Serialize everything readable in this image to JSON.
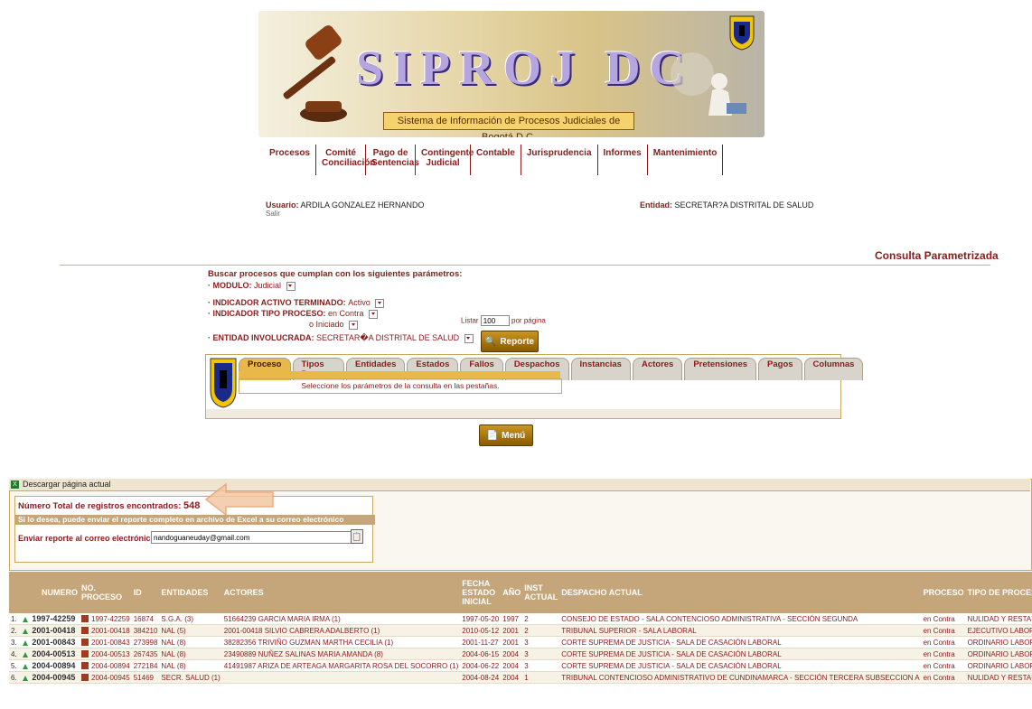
{
  "banner": {
    "title": "SIPROJ DC",
    "subtitle": "Sistema de Información de Procesos Judiciales de Bogotá D.C."
  },
  "menu": [
    "Procesos",
    "Comité Conciliación",
    "Pago de Sentencias",
    "Contingente Judicial",
    "Contable",
    "Jurisprudencia",
    "Informes",
    "Mantenimiento"
  ],
  "user": {
    "label": "Usuario:",
    "name": "ARDILA GONZALEZ HERNANDO",
    "logout": "Salir",
    "entity_label": "Entidad:",
    "entity": "SECRETAR?A DISTRITAL DE SALUD"
  },
  "page_title": "Consulta Parametrizada",
  "params": {
    "heading": "Buscar procesos que cumplan con los siguientes parámetros:",
    "modulo_label": "· MODULO:",
    "modulo_value": "Judicial",
    "indicador_activo_label": "· INDICADOR ACTIVO TERMINADO:",
    "indicador_activo_value": "Activo",
    "indicador_tipo_label": "· INDICADOR TIPO PROCESO:",
    "indicador_tipo_value1": "en Contra",
    "indicador_tipo_value2": "o Iniciado",
    "entidad_label": "· ENTIDAD INVOLUCRADA:",
    "entidad_value": "SECRETAR�A DISTRITAL DE SALUD",
    "listar_label": "Listar",
    "listar_value": "100",
    "por_pagina": "por página",
    "reporte_button": "Reporte"
  },
  "tabs": {
    "items": [
      "Proceso",
      "Tipos Proceso",
      "Entidades",
      "Estados",
      "Fallos",
      "Despachos",
      "Instancias",
      "Actores",
      "Pretensiones",
      "Pagos",
      "Columnas"
    ],
    "active": "Proceso",
    "message": "Seleccione los parámetros de la consulta en las pestañas."
  },
  "menu_button": "Menú",
  "results": {
    "download_label": "Descargar página actual",
    "total_label": "Número Total de registros encontrados:",
    "total_value": "548",
    "excel_note": "Si lo desea, puede enviar el reporte completo en archivo de Excel a su correo electrónico",
    "email_label": "Enviar reporte al correo electrónico",
    "email_value": "nandoguaneuday@gmail.com"
  },
  "table": {
    "headers": [
      "NUMERO",
      "NO. PROCESO",
      "ID",
      "ENTIDADES",
      "ACTORES",
      "FECHA ESTADO INICIAL",
      "AÑO",
      "INST ACTUAL",
      "DESPACHO ACTUAL",
      "PROCESO",
      "TIPO DE PROCESO"
    ],
    "rows": [
      {
        "idx": "1.",
        "numero": "1997-42259",
        "no_proceso": "1997-42259",
        "id": "16874",
        "entidades": "S.G.A. (3)",
        "actores": "51664239 GARCIA MARIA IRMA (1)",
        "fecha": "1997-05-20",
        "anio": "1997",
        "inst": "2",
        "despacho": "CONSEJO DE ESTADO - SALA CONTENCIOSO ADMINISTRATIVA - SECCIÓN SEGUNDA",
        "proceso": "en Contra",
        "tipo": "NULIDAD Y RESTABLECIMIENTO"
      },
      {
        "idx": "2.",
        "numero": "2001-00418",
        "no_proceso": "2001-00418",
        "id": "384210",
        "entidades": "NAL (5)",
        "actores": "2001-00418 SILVIO CABRERA ADALBERTO (1)",
        "fecha": "2010-05-12",
        "anio": "2001",
        "inst": "2",
        "despacho": "TRIBUNAL SUPERIOR - SALA LABORAL",
        "proceso": "en Contra",
        "tipo": "EJECUTIVO LABORAL"
      },
      {
        "idx": "3.",
        "numero": "2001-00843",
        "no_proceso": "2001-00843",
        "id": "273998",
        "entidades": "NAL (8)",
        "actores": "38282356 TRIVIÑO GUZMAN MARTHA CECILIA (1)",
        "fecha": "2001-11-27",
        "anio": "2001",
        "inst": "3",
        "despacho": "CORTE SUPREMA DE JUSTICIA - SALA DE CASACIÓN LABORAL",
        "proceso": "en Contra",
        "tipo": "ORDINARIO LABORAL"
      },
      {
        "idx": "4.",
        "numero": "2004-00513",
        "no_proceso": "2004-00513",
        "id": "267435",
        "entidades": "NAL (8)",
        "actores": "23490889 NUÑEZ SALINAS MARIA AMANDA (8)",
        "fecha": "2004-06-15",
        "anio": "2004",
        "inst": "3",
        "despacho": "CORTE SUPREMA DE JUSTICIA - SALA DE CASACIÓN LABORAL",
        "proceso": "en Contra",
        "tipo": "ORDINARIO LABORAL"
      },
      {
        "idx": "5.",
        "numero": "2004-00894",
        "no_proceso": "2004-00894",
        "id": "272184",
        "entidades": "NAL (8)",
        "actores": "41491987 ARIZA DE ARTEAGA MARGARITA ROSA DEL SOCORRO (1)",
        "fecha": "2004-06-22",
        "anio": "2004",
        "inst": "3",
        "despacho": "CORTE SUPREMA DE JUSTICIA - SALA DE CASACIÓN LABORAL",
        "proceso": "en Contra",
        "tipo": "ORDINARIO LABORAL"
      },
      {
        "idx": "6.",
        "numero": "2004-00945",
        "no_proceso": "2004-00945",
        "id": "51469",
        "entidades": "SECR. SALUD (1)",
        "actores": "",
        "fecha": "2004-08-24",
        "anio": "2004",
        "inst": "1",
        "despacho": "TRIBUNAL CONTENCIOSO ADMINISTRATIVO DE CUNDINAMARCA - SECCIÓN TERCERA SUBSECCION A",
        "proceso": "en Contra",
        "tipo": "NULIDAD Y RESTABLECIMIENTO"
      }
    ]
  }
}
